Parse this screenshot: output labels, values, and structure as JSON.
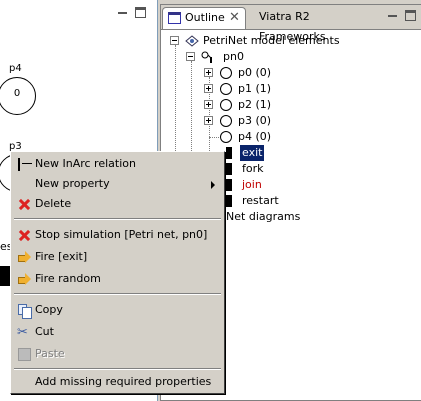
{
  "editor": {
    "places": [
      {
        "label": "p4",
        "count": "0"
      },
      {
        "label": "p3",
        "count": ""
      }
    ],
    "partial_text": "es"
  },
  "outline": {
    "tabs": {
      "outline_label": "Outline",
      "viatra_label": "Viatra R2 Frameworks"
    },
    "tree": {
      "root_label": "PetriNet model elements",
      "net_label": "pn0",
      "places": [
        "p0 (0)",
        "p1 (1)",
        "p2 (1)",
        "p3 (0)",
        "p4 (0)"
      ],
      "transitions": [
        "exit",
        "fork",
        "join",
        "restart"
      ],
      "diagrams_label": "iNet diagrams"
    },
    "selected_item": "exit",
    "highlight_color": "#c00000"
  },
  "context_menu": {
    "items": [
      {
        "label": "New InArc relation",
        "icon": "arc-icon"
      },
      {
        "label": "New property",
        "icon": "",
        "submenu": true
      },
      {
        "label": "Delete",
        "icon": "delete-icon"
      },
      {
        "label": "Stop simulation [Petri net, pn0]",
        "icon": "stop-icon"
      },
      {
        "label": "Fire [exit]",
        "icon": "fire-icon"
      },
      {
        "label": "Fire random",
        "icon": "fire-random-icon"
      },
      {
        "label": "Copy",
        "icon": "copy-icon"
      },
      {
        "label": "Cut",
        "icon": "cut-icon"
      },
      {
        "label": "Paste",
        "icon": "paste-icon",
        "disabled": true
      },
      {
        "label": "Add missing required properties",
        "icon": ""
      }
    ]
  }
}
